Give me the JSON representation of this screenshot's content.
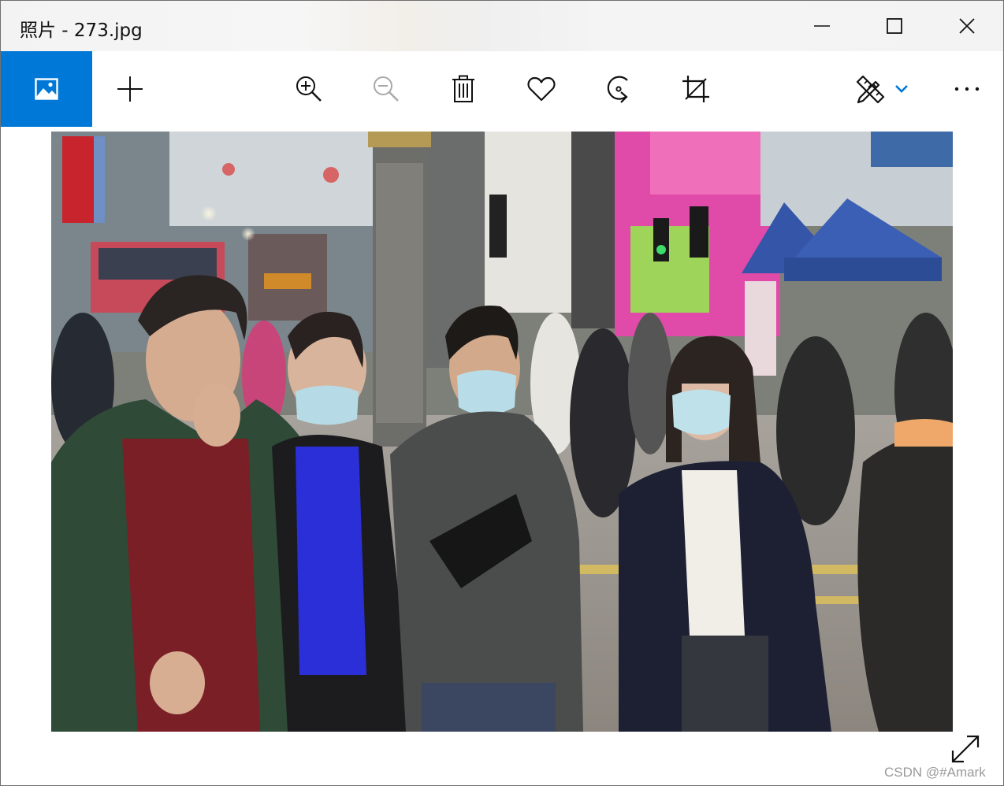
{
  "window": {
    "title": "照片 - 273.jpg"
  },
  "title_controls": {
    "minimize": "minimize-icon",
    "maximize": "maximize-icon",
    "close": "close-icon"
  },
  "toolbar": {
    "accent_color": "#0078d7",
    "buttons": [
      {
        "name": "home-button",
        "icon": "image-icon"
      },
      {
        "name": "add-button",
        "icon": "plus-icon"
      },
      {
        "name": "zoom-in-button",
        "icon": "zoom-in-icon"
      },
      {
        "name": "zoom-out-button",
        "icon": "zoom-out-icon",
        "state": "disabled"
      },
      {
        "name": "delete-button",
        "icon": "trash-icon"
      },
      {
        "name": "favorite-button",
        "icon": "heart-icon"
      },
      {
        "name": "rotate-button",
        "icon": "rotate-icon"
      },
      {
        "name": "crop-button",
        "icon": "crop-icon"
      },
      {
        "name": "edit-draw-button",
        "icon": "pen-ruler-icon"
      },
      {
        "name": "edit-dropdown-button",
        "icon": "chevron-down-icon"
      },
      {
        "name": "more-button",
        "icon": "ellipsis-icon"
      }
    ]
  },
  "photo": {
    "subject": "masked pedestrians on city street"
  },
  "viewer": {
    "fullscreen_icon": "expand-diagonal-icon"
  },
  "watermark": {
    "text": "CSDN @#Amark"
  }
}
